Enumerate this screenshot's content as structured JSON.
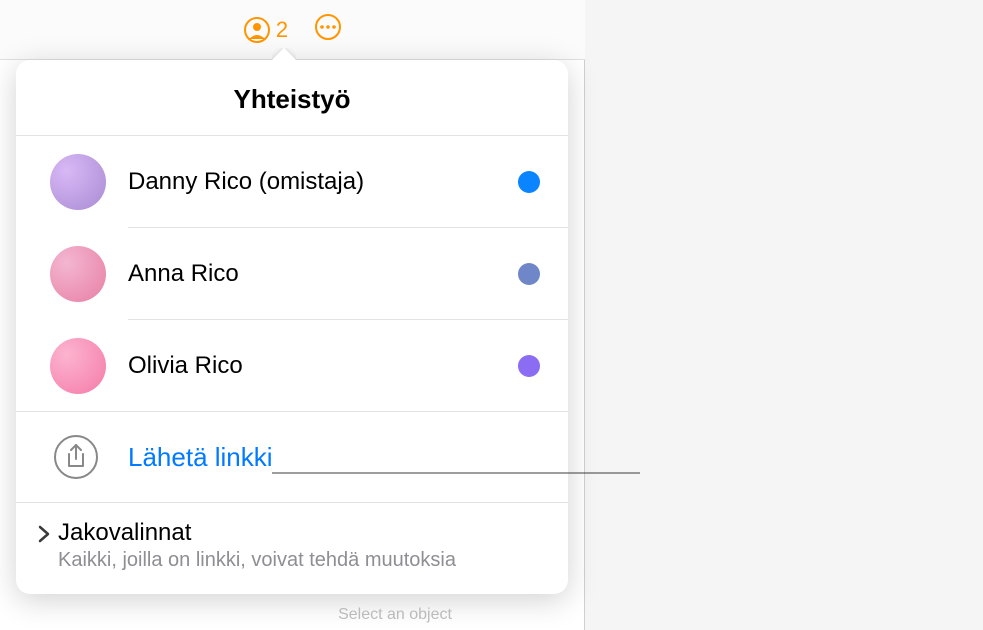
{
  "toolbar": {
    "collaborator_count": "2"
  },
  "popover": {
    "title": "Yhteistyö",
    "collaborators": [
      {
        "name": "Danny Rico (omistaja)",
        "dot_color": "#0a84ff",
        "avatar_bg": "radial-gradient(circle at 30% 30%, #d8b8f5, #a98bd4)"
      },
      {
        "name": "Anna Rico",
        "dot_color": "#6f87c9",
        "avatar_bg": "radial-gradient(circle at 30% 30%, #f3b6d0, #e87fa5)"
      },
      {
        "name": "Olivia Rico",
        "dot_color": "#8a6df2",
        "avatar_bg": "radial-gradient(circle at 30% 30%, #fcb4cf, #f57aa9)"
      }
    ],
    "send_link_label": "Lähetä linkki",
    "share_options": {
      "title": "Jakovalinnat",
      "subtitle": "Kaikki, joilla on linkki, voivat tehdä muutoksia"
    }
  },
  "colors": {
    "accent_orange": "#ff9500",
    "link_blue": "#007aff"
  },
  "bg_hint": "Select an object"
}
